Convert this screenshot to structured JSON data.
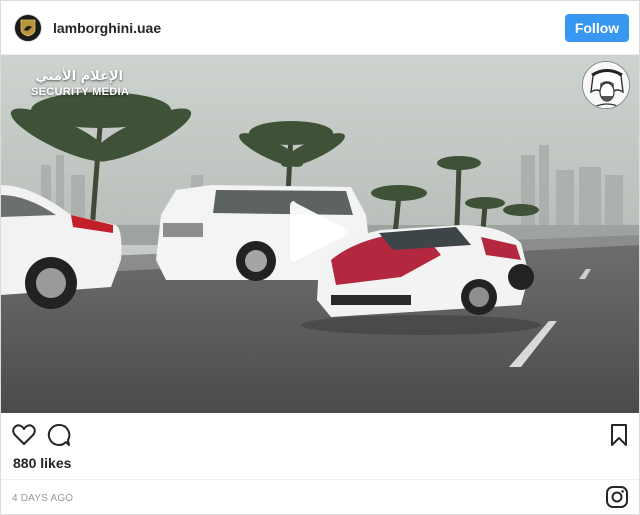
{
  "header": {
    "username": "lamborghini.uae",
    "follow_label": "Follow"
  },
  "media": {
    "watermark_arabic": "الإعلام الأمني",
    "watermark_english": "SECURITY MEDIA",
    "kind": "video",
    "play_icon": "play-icon"
  },
  "actions": {
    "like_icon": "heart-icon",
    "comment_icon": "comment-icon",
    "save_icon": "bookmark-icon"
  },
  "post": {
    "likes": "880 likes",
    "timestamp": "4 DAYS AGO"
  },
  "footer": {
    "brand_icon": "instagram-icon"
  },
  "colors": {
    "follow_button": "#3897f0",
    "text": "#262626",
    "muted": "#999999",
    "border": "#dbdbdb"
  }
}
